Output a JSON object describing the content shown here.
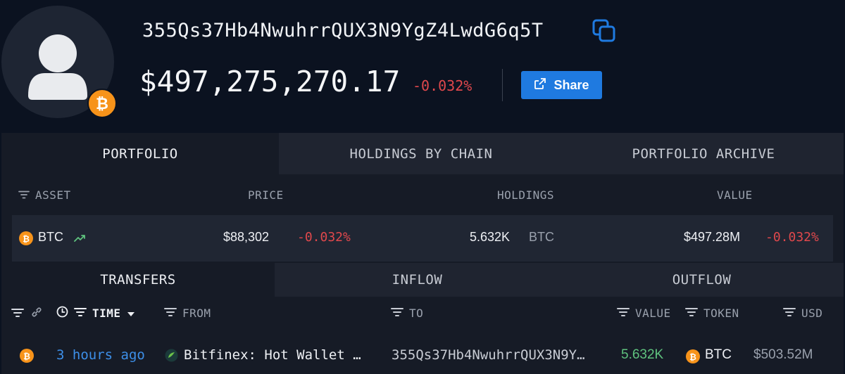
{
  "header": {
    "address": "355Qs37Hb4NwuhrrQUX3N9YgZ4LwdG6q5T",
    "total_value": "$497,275,270.17",
    "total_change": "-0.032%",
    "share_label": "Share"
  },
  "colors": {
    "accent": "#1f7ae0",
    "negative": "#e0484c",
    "positive": "#5fc27e",
    "btc": "#f7931a",
    "background": "#0b1220",
    "panel": "#161b26"
  },
  "portfolio_tabs": [
    "PORTFOLIO",
    "HOLDINGS BY CHAIN",
    "PORTFOLIO ARCHIVE"
  ],
  "portfolio_columns": {
    "asset": "ASSET",
    "price": "PRICE",
    "holdings": "HOLDINGS",
    "value": "VALUE"
  },
  "asset_row": {
    "symbol": "BTC",
    "price": "$88,302",
    "price_change": "-0.032%",
    "holdings_amount": "5.632K",
    "holdings_unit": "BTC",
    "value": "$497.28M",
    "value_change": "-0.032%"
  },
  "transfer_tabs": [
    "TRANSFERS",
    "INFLOW",
    "OUTFLOW"
  ],
  "transfer_columns": {
    "time": "TIME",
    "from": "FROM",
    "to": "TO",
    "value": "VALUE",
    "token": "TOKEN",
    "usd": "USD"
  },
  "transfer_row": {
    "time": "3 hours ago",
    "from": "Bitfinex: Hot Wallet …",
    "to": "355Qs37Hb4NwuhrrQUX3N9Y…",
    "value": "5.632K",
    "token": "BTC",
    "usd": "$503.52M"
  },
  "icons": [
    "user-avatar-icon",
    "bitcoin-icon",
    "copy-icon",
    "share-icon",
    "filter-icon",
    "link-icon",
    "clock-icon",
    "sort-desc-icon",
    "trend-up-icon",
    "bitfinex-icon"
  ]
}
